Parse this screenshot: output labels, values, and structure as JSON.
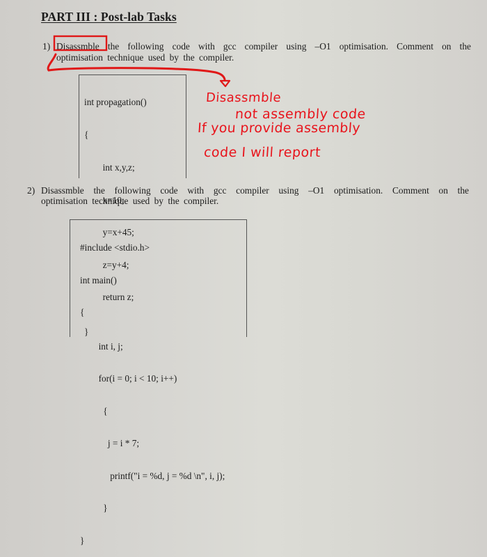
{
  "document": {
    "heading": "PART III : Post-lab Tasks",
    "questions": [
      {
        "number": "1)",
        "line1": "Disassmble the following code with gcc compiler using -O1 optimisation. Comment on the",
        "line2": "optimisation technique used by the compiler.",
        "highlighted_word": "Disassmble",
        "line1_rest": "the following code with gcc compiler using –O1 optimisation. Comment on the",
        "code": [
          "int propagation()",
          "{",
          "        int x,y,z;",
          "        x=10;",
          "        y=x+45;",
          "        z=y+4;",
          "        return z;",
          "}"
        ]
      },
      {
        "number": "2)",
        "line1": "Disassmble the following code with gcc compiler using –O1 optimisation. Comment on the",
        "line2": "optimisation technique used by the compiler.",
        "code": [
          "#include <stdio.h>",
          "int main()",
          "{",
          "        int i, j;",
          "        for(i = 0; i < 10; i++)",
          "          {",
          "            j = i * 7;",
          "             printf(\"i = %d, j = %d \\n\", i, j);",
          "          }",
          "}"
        ]
      }
    ],
    "handwritten_note": {
      "lines": [
        "Disassmble",
        "not assembly code",
        "If you provide assembly",
        "code I will report"
      ],
      "color": "#e8141c"
    }
  }
}
